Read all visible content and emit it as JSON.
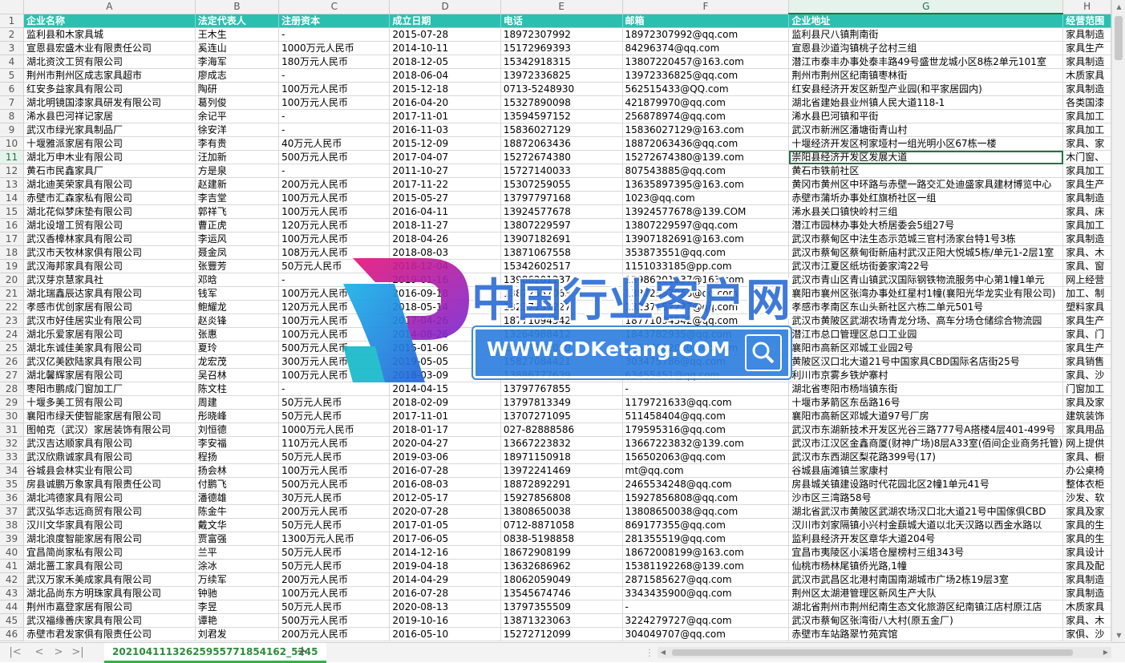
{
  "columns": [
    "A",
    "B",
    "C",
    "D",
    "E",
    "F",
    "G",
    "H"
  ],
  "selected_column": "G",
  "selected_row": 11,
  "header_row": [
    "企业名称",
    "法定代表人",
    "注册资本",
    "成立日期",
    "电话",
    "邮箱",
    "企业地址",
    "经营范围"
  ],
  "rows": [
    [
      "监利县和木家具城",
      "王木生",
      "-",
      "2015-07-28",
      "18972307992",
      "18972307992@qq.com",
      "监利县尺八镇荆南街",
      "家具制造"
    ],
    [
      "宣恩县宏盛木业有限责任公司",
      "奚连山",
      "1000万元人民币",
      "2014-10-11",
      "15172969393",
      "84296374@qq.com",
      "宣恩县沙道沟镇桃子岔村三组",
      "家具生产"
    ],
    [
      "湖北资汶工贸有限公司",
      "李海军",
      "180万元人民币",
      "2018-12-05",
      "15342918315",
      "13807220457@163.com",
      "潜江市泰丰办事处泰丰路49号盛世龙城小区8栋2单元101室",
      "家具制造"
    ],
    [
      "荆州市荆州区成志家具超市",
      "廖成志",
      "-",
      "2018-06-04",
      "13972336825",
      "13972336825@qq.com",
      "荆州市荆州区纪南镇枣林街",
      "木质家具"
    ],
    [
      "红安多益家具有限公司",
      "陶研",
      "100万元人民币",
      "2015-12-18",
      "0713-5248930",
      "562515433@QQ.com",
      "红安县经济开发区新型产业园(和平家居园内)",
      "家具制造"
    ],
    [
      "湖北明镜国漆家具研发有限公司",
      "葛列俊",
      "100万元人民币",
      "2016-04-20",
      "15327890098",
      "421879970@qq.com",
      "湖北省建始县业州镇人民大道118-1",
      "各类国漆"
    ],
    [
      "浠水县巴河祥记家居",
      "余记平",
      "-",
      "2017-11-01",
      "13594597152",
      "256878974@qq.com",
      "浠水县巴河镇和平街",
      "家具加工"
    ],
    [
      "武汉市绿光家具制品厂",
      "徐安洋",
      "-",
      "2016-11-03",
      "15836027129",
      "15836027129@163.com",
      "武汉市新洲区潘塘街青山村",
      "家具加工"
    ],
    [
      "十堰雅派家居有限公司",
      "李有贵",
      "40万元人民币",
      "2015-12-09",
      "18872063436",
      "18872063436@qq.com",
      "十堰经济开发区柯家垭村一组光明小区67栋一楼",
      "家具、家"
    ],
    [
      "湖北万申木业有限公司",
      "汪加新",
      "500万元人民币",
      "2017-04-07",
      "15272674380",
      "15272674380@139.com",
      "崇阳县经济开发区发展大道",
      "木门窗、"
    ],
    [
      "黄石市民鑫家具厂",
      "方是泉",
      "-",
      "2011-10-27",
      "15727140033",
      "807543885@qq.com",
      "黄石市铁前社区",
      "家具加工"
    ],
    [
      "湖北迪芙荣家具有限公司",
      "赵建新",
      "200万元人民币",
      "2017-11-22",
      "15307259055",
      "13635897395@163.com",
      "黄冈市黄州区中环路与赤壁一路交汇处迪盛家具建材博览中心",
      "家具生产"
    ],
    [
      "赤壁市汇森家私有限公司",
      "李吉堂",
      "100万元人民币",
      "2015-05-27",
      "13797797168",
      "1023@qq.com",
      "赤壁市蒲圻办事处红旗桥社区一组",
      "家具制造"
    ],
    [
      "湖北花似梦床垫有限公司",
      "郭祥飞",
      "100万元人民币",
      "2016-04-11",
      "13924577678",
      "13924577678@139.COM",
      "浠水县关口镇快岭村三组",
      "家具、床"
    ],
    [
      "湖北设增工贸有限公司",
      "曹正虎",
      "120万元人民币",
      "2018-11-27",
      "13807229597",
      "13807229597@qq.com",
      "潜江市园林办事处大桥居委会5组27号",
      "家具加工"
    ],
    [
      "武汉香樟林家具有限公司",
      "李运风",
      "100万元人民币",
      "2018-04-26",
      "13907182691",
      "13907182691@163.com",
      "武汉市蔡甸区中法生态示范城三官村汤家台特1号3栋",
      "家具制造"
    ],
    [
      "武汉市天牧林家俱有限公司",
      "聂金凤",
      "108万元人民币",
      "2018-08-03",
      "13871067558",
      "353873551@qq.com",
      "武汉市蔡甸区蔡甸街新庙村武汉正阳大悦城5栋/单元1-2层1室",
      "家具、木"
    ],
    [
      "武汉海邦家具有限公司",
      "张豐芳",
      "50万元人民币",
      "2018-12-04",
      "15342602517",
      "1151033185@pp.com",
      "武汉市江夏区纸坊街姜家湾22号",
      "家具、窗"
    ],
    [
      "武汉芽京慧家具社",
      "邓晗",
      "-",
      "2019-01-16",
      "13986201237",
      "13986201237@163.com",
      "武汉市青山区青山镇武汉国际钢铁物流服务中心第1幢1单元",
      "网上经营"
    ],
    [
      "湖北瑞鑫辰达家具有限公司",
      "钱军",
      "100万元人民币",
      "2016-09-18",
      "13872557063",
      "13872557063@qq.com",
      "襄阳市襄州区张湾办事处红星村1幢(襄阳光华龙实业有限公司)",
      "加工、制"
    ],
    [
      "孝感市优创家居有限公司",
      "鲍耀龙",
      "120万元人民币",
      "2018-05-14",
      "13237157227",
      "13237157227@qq.com",
      "孝感市孝南区东山头新社区六栋二单元501号",
      "塑料家具"
    ],
    [
      "武汉市好佳居实业有限公司",
      "赵炎锋",
      "100万元人民币",
      "2017-04-26",
      "18771094542",
      "18771094542@qq.com",
      "武汉市黄陂区武湖农场青龙分场、高车分场仓储综合物流园",
      "家具生产"
    ],
    [
      "湖北乐爱家居有限公司",
      "张惠",
      "100万元人民币",
      "2014-08-26",
      "13264988412",
      "1843782935@qq.com",
      "潜江市总口管理区总口工业园",
      "家具、门"
    ],
    [
      "湖北东诚佳美家具有限公司",
      "夏玲",
      "500万元人民币",
      "2015-01-06",
      "13597662030",
      "13597662030@qq.com",
      "襄阳市高新区邓城工业园2号",
      "家具生产"
    ],
    [
      "武汉亿美欧陆家具有限公司",
      "龙宏茂",
      "300万元人民币",
      "2019-05-05",
      "15827084421",
      "303475786@qq.com",
      "黄陂区汉口北大道21号中国家具CBD国际名店街25号",
      "家具销售"
    ],
    [
      "湖北馨辉家居有限公司",
      "吴召林",
      "100万元人民币",
      "2018-03-09",
      "13886777639",
      "63455451@qq.com",
      "利川市京雾乡铁炉寨村",
      "家具、沙"
    ],
    [
      "枣阳市鹏成门窗加工厂",
      "陈文柱",
      "-",
      "2014-04-15",
      "13797767855",
      "-",
      "湖北省枣阳市杨垱镇东街",
      "门窗加工"
    ],
    [
      "十堰多美工贸有限公司",
      "周建",
      "50万元人民币",
      "2018-02-09",
      "13797813349",
      "1179721633@qq.com",
      "十堰市茅箭区东岳路16号",
      "家具及家"
    ],
    [
      "襄阳市绿天使智能家居有限公司",
      "彤晓峰",
      "50万元人民币",
      "2017-11-01",
      "13707271095",
      "511458404@qq.com",
      "襄阳市高新区邓城大道97号厂房",
      "建筑装饰"
    ],
    [
      "图帕克（武汉）家居装饰有限公司",
      "刘恒德",
      "1000万元人民币",
      "2018-01-17",
      "027-82888586",
      "179595316@qq.com",
      "武汉市东湖新技术开发区光谷三路777号A搭楼4层401-499号",
      "家具用品"
    ],
    [
      "武汉吉达顺家具有限公司",
      "李安福",
      "110万元人民币",
      "2020-04-27",
      "13667223832",
      "13667223832@139.com",
      "武汉市江汉区金鑫商厦(财神广场)8层A33室(佰间企业商务托管)",
      "网上提供"
    ],
    [
      "武汉欣鼎诚家具有限公司",
      "程扬",
      "50万元人民币",
      "2019-03-06",
      "18971150918",
      "156502063@qq.com",
      "武汉市东西湖区梨花路399号(17)",
      "家具、橱"
    ],
    [
      "谷城县会林实业有限公司",
      "扬会林",
      "100万元人民币",
      "2016-07-28",
      "13972241469",
      "mt@qq.com",
      "谷城县庙滩镇兰家康村",
      "办公桌椅"
    ],
    [
      "房县诚鹏万象家具有限责任公司",
      "付鹏飞",
      "500万元人民币",
      "2016-08-03",
      "18872892291",
      "2465534248@qq.com",
      "房县城关镇建设路时代花园北区2幢1单元41号",
      "整体衣柜"
    ],
    [
      "湖北鸿德家具有限公司",
      "潘德雄",
      "30万元人民币",
      "2012-05-17",
      "15927856808",
      "15927856808@qq.com",
      "沙市区三湾路58号",
      "沙发、软"
    ],
    [
      "武汉弘华志远商贸有限公司",
      "陈金牛",
      "200万元人民币",
      "2020-07-28",
      "13808650038",
      "13808650038@qq.com",
      "湖北省武汉市黄陂区武湖农场汉口北大道21号中国傢俱CBD",
      "家具及家"
    ],
    [
      "汉川文华家具有限公司",
      "戴文华",
      "50万元人民币",
      "2017-01-05",
      "0712-8871058",
      "869177355@qq.com",
      "汉川市刘家隔镇小兴村金蕻城大道以北天汉路以西金水路以",
      "家具的生"
    ],
    [
      "湖北浪度智能家居有限公司",
      "贾富强",
      "1300万元人民币",
      "2017-06-05",
      "0838-5198858",
      "281355519@qq.com",
      "监利县经济开发区章华大道204号",
      "家具的生"
    ],
    [
      "宜昌简尚家私有限公司",
      "兰平",
      "50万元人民币",
      "2014-12-16",
      "18672908199",
      "18672008199@163.com",
      "宜昌市夷陵区小溪塔仓屋榜村三组343号",
      "家具设计"
    ],
    [
      "湖北蔷工家具有限公司",
      "涂冰",
      "50万元人民币",
      "2019-04-18",
      "13632686962",
      "15381192268@139.com",
      "仙桃市杨林尾镇侨光路,1幢",
      "家具及配"
    ],
    [
      "武汉万家禾美成家具有限公司",
      "万续军",
      "200万元人民币",
      "2014-04-29",
      "18062059049",
      "2871585627@qq.com",
      "武汉市武昌区北港村南国南湖城市广场2栋19层3室",
      "家具制造"
    ],
    [
      "湖北品尚东方明珠家具有限公司",
      "钟驰",
      "100万元人民币",
      "2016-07-28",
      "13545674746",
      "3343435900@qq.com",
      "荆州区太湖港管理区新风生产大队",
      "家具制造"
    ],
    [
      "荆州市嘉登家居有限公司",
      "李昱",
      "50万元人民币",
      "2020-08-13",
      "13797355509",
      "-",
      "湖北省荆州市荆州纪南生态文化旅游区纪南镇江店村原江店",
      "木质家具"
    ],
    [
      "武汉福缘善庆家具有限公司",
      "谭艳",
      "500万元人民币",
      "2019-10-16",
      "13871323063",
      "3224279727@qq.com",
      "武汉市蔡甸区张湾街八大村(原五金厂)",
      "家具、木"
    ],
    [
      "赤壁市君发家俱有限责任公司",
      "刘君发",
      "200万元人民币",
      "2016-05-10",
      "15272712099",
      "304049707@qq.com",
      "赤壁市车站路翠竹苑宾馆",
      "家俱、沙"
    ]
  ],
  "sheet_tab": "20210411132625955771854162_5245",
  "watermark": {
    "title": "中国行业客户网",
    "url": "WWW.CDKetang.COM"
  },
  "colors": {
    "header_fill": "#2bbfb0",
    "accent": "#217346",
    "tab_underline": "#2eb34a",
    "watermark_blue": "#2f6fd6"
  }
}
